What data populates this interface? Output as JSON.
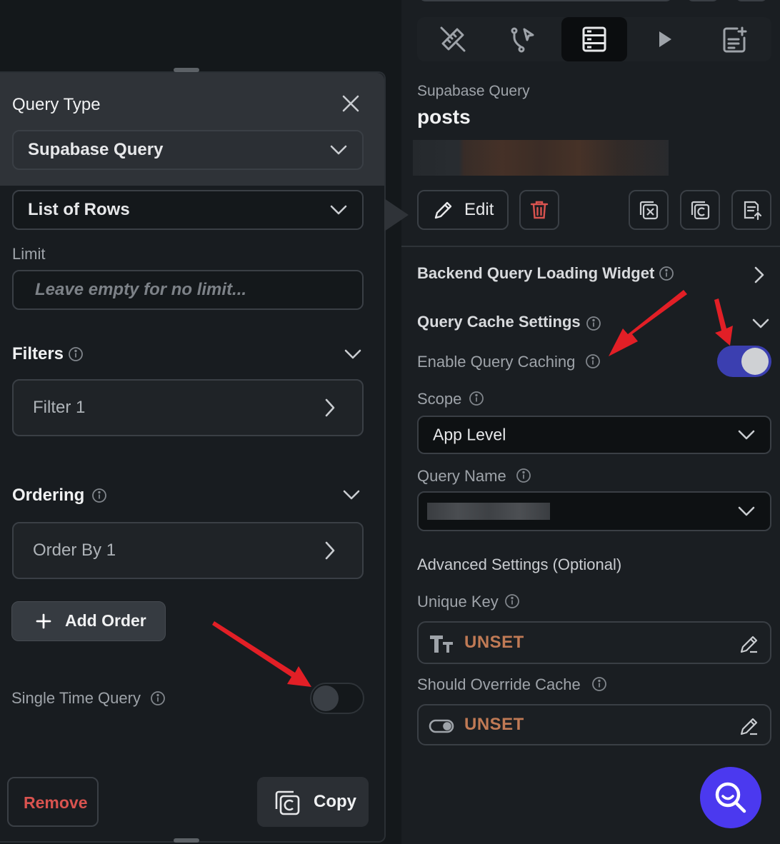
{
  "left": {
    "query_type_label": "Query Type",
    "query_type_value": "Supabase Query",
    "operation_value": "List of Rows",
    "limit_label": "Limit",
    "limit_placeholder": "Leave empty for no limit...",
    "filters_title": "Filters",
    "filter_item": "Filter 1",
    "ordering_title": "Ordering",
    "order_item": "Order By 1",
    "add_order_label": "Add Order",
    "single_time_query_label": "Single Time Query",
    "remove_label": "Remove",
    "copy_label": "Copy"
  },
  "right": {
    "tabs": [
      "ruler-pencil",
      "branch-cursor",
      "database",
      "play",
      "document-add"
    ],
    "query_kind": "Supabase Query",
    "query_name": "posts",
    "edit_label": "Edit",
    "backend_loading_widget_label": "Backend Query Loading Widget",
    "cache_settings_title": "Query Cache Settings",
    "enable_caching_label": "Enable Query Caching",
    "scope_label": "Scope",
    "scope_value": "App Level",
    "query_name_label": "Query Name",
    "advanced_title": "Advanced Settings (Optional)",
    "unique_key_label": "Unique Key",
    "unique_key_value": "UNSET",
    "override_cache_label": "Should Override Cache",
    "override_cache_value": "UNSET"
  },
  "state": {
    "enable_query_caching": true,
    "single_time_query": false
  },
  "colors": {
    "toggle_on": "#3b3fb0",
    "accent_search": "#4b39ef",
    "danger": "#d9534f",
    "unset": "#c07a55",
    "arrow": "#e21f26"
  }
}
